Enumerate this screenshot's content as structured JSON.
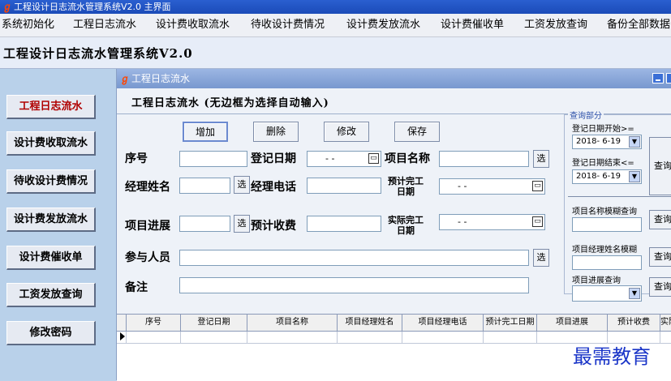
{
  "window": {
    "title": "工程设计日志流水管理系统V2.0 主界面"
  },
  "menu": [
    "系统初始化",
    "工程日志流水",
    "设计费收取流水",
    "待收设计费情况",
    "设计费发放流水",
    "设计费催收单",
    "工资发放查询",
    "备份全部数据"
  ],
  "app": {
    "title": "工程设计日志流水管理系统V2.0"
  },
  "nav": [
    "工程日志流水",
    "设计费收取流水",
    "待收设计费情况",
    "设计费发放流水",
    "设计费催收单",
    "工资发放查询",
    "修改密码"
  ],
  "child": {
    "title": "工程日志流水",
    "subtitle": "工程日志流水 (无边框为选择自动输入)"
  },
  "toolbar": {
    "add": "增加",
    "delete": "删除",
    "edit": "修改",
    "save": "保存"
  },
  "form": {
    "serial_label": "序号",
    "reg_date_label": "登记日期",
    "reg_date_value": "- -",
    "project_name_label": "项目名称",
    "manager_name_label": "经理姓名",
    "manager_phone_label": "经理电话",
    "planned_finish_label": "预计完工日期",
    "planned_finish_value": "- -",
    "progress_label": "项目进展",
    "planned_fee_label": "预计收费",
    "actual_finish_label": "实际完工日期",
    "actual_finish_value": "- -",
    "participants_label": "参与人员",
    "remarks_label": "备注",
    "select_label": "选"
  },
  "query": {
    "legend": "查询部分",
    "start_label": "登记日期开始>=",
    "start_value": "2018- 6-19",
    "end_label": "登记日期结束<=",
    "end_value": "2018- 6-19",
    "query_btn": "查询",
    "name_fuzzy_label": "项目名称模糊查询",
    "manager_fuzzy_label": "项目经理姓名模糊",
    "progress_query_label": "项目进展查询"
  },
  "grid": {
    "columns": [
      "序号",
      "登记日期",
      "项目名称",
      "项目经理姓名",
      "项目经理电话",
      "预计完工日期",
      "项目进展",
      "预计收费",
      "实际"
    ]
  },
  "watermark": "最需教育",
  "icons": {
    "app": "app-logo-icon",
    "calendar": "calendar-icon",
    "dropdown": "chevron-down-icon",
    "row": "row-pointer-icon"
  }
}
